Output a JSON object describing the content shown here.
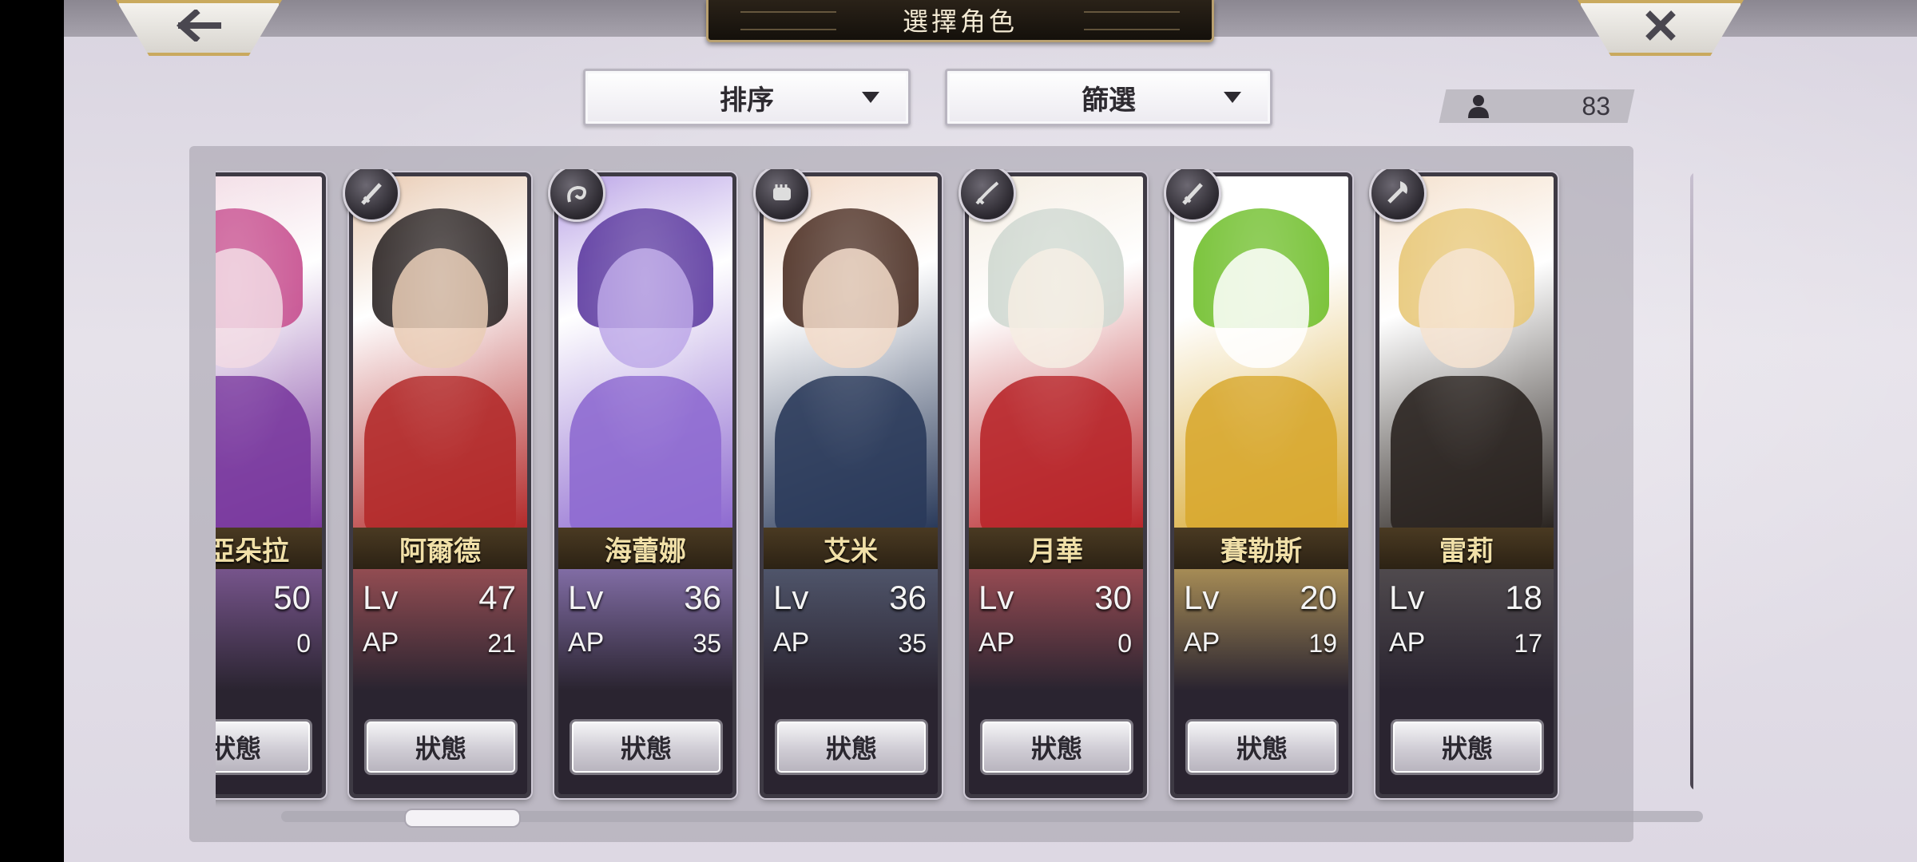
{
  "header": {
    "title": "選擇角色",
    "back_icon": "arrow-left-icon",
    "close_icon": "close-x-icon"
  },
  "controls": {
    "sort_label": "排序",
    "filter_label": "篩選",
    "character_count": "83"
  },
  "stat_labels": {
    "lv": "Lv",
    "ap": "AP"
  },
  "status_button_label": "狀態",
  "characters": [
    {
      "name": "蒂亞朵拉",
      "lv": "50",
      "ap": "0",
      "weapon_icon": "axe-icon",
      "palette": [
        "#c64e8e",
        "#7a3a9e",
        "#f0d6e0"
      ]
    },
    {
      "name": "阿爾德",
      "lv": "47",
      "ap": "21",
      "weapon_icon": "sword-icon",
      "palette": [
        "#2a2424",
        "#b22a2a",
        "#e8c9b0"
      ]
    },
    {
      "name": "海蕾娜",
      "lv": "36",
      "ap": "35",
      "weapon_icon": "whip-icon",
      "palette": [
        "#5c3aa0",
        "#8e6ad0",
        "#b9a2e6"
      ]
    },
    {
      "name": "艾米",
      "lv": "36",
      "ap": "35",
      "weapon_icon": "fist-icon",
      "palette": [
        "#4a2e22",
        "#2a3a5a",
        "#f2d8c4"
      ]
    },
    {
      "name": "月華",
      "lv": "30",
      "ap": "0",
      "weapon_icon": "katana-icon",
      "palette": [
        "#cfd8d0",
        "#b8262a",
        "#f4ece0"
      ]
    },
    {
      "name": "賽勒斯",
      "lv": "20",
      "ap": "19",
      "weapon_icon": "sword-icon",
      "palette": [
        "#6fbf2a",
        "#d8a830",
        "#ffffff"
      ]
    },
    {
      "name": "雷莉",
      "lv": "18",
      "ap": "17",
      "weapon_icon": "axe-icon",
      "palette": [
        "#e8c878",
        "#2a2420",
        "#f4e0cc"
      ]
    }
  ],
  "scroll": {
    "position_fraction": 0.1
  }
}
